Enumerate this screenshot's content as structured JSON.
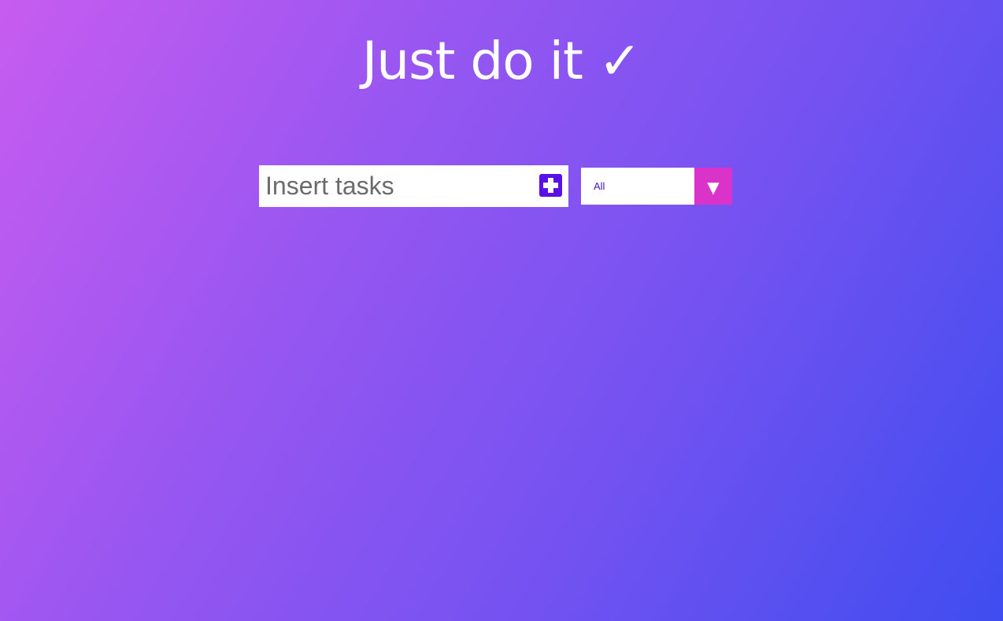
{
  "app": {
    "title": "Just do it ✓"
  },
  "task_form": {
    "input_value": "",
    "input_placeholder": "Insert tasks",
    "add_icon": "plus-icon"
  },
  "filter": {
    "selected": "All",
    "arrow_icon": "triangle-down-icon",
    "arrow_glyph": "▼"
  },
  "todos": [],
  "colors": {
    "background_start": "#c75cf0",
    "background_end": "#3f4df0",
    "add_button": "#5b0fe8",
    "filter_arrow": "#d933c9",
    "filter_text": "#3b18c4"
  }
}
